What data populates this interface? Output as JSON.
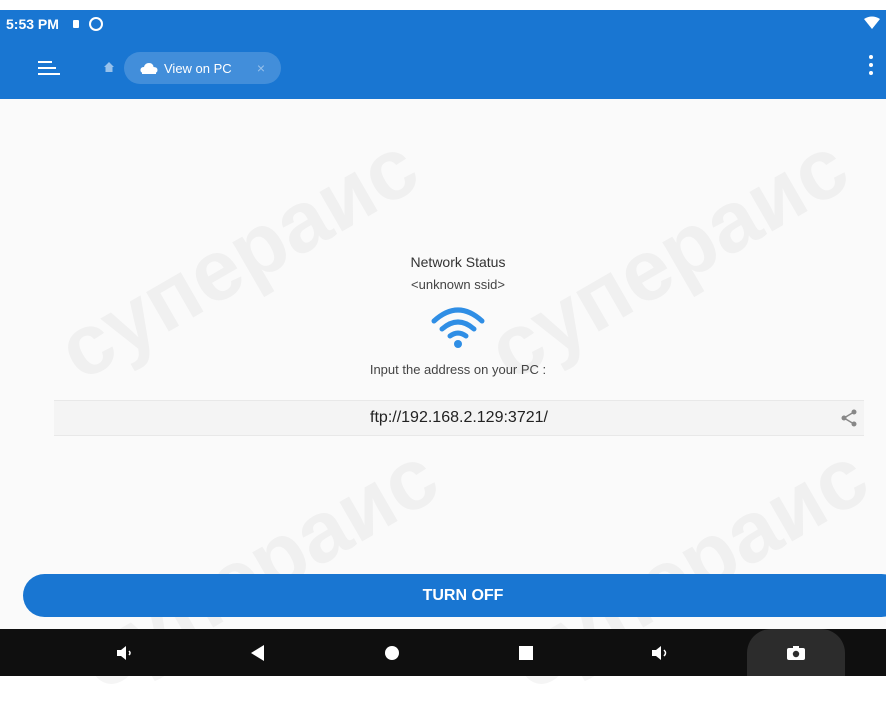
{
  "status_bar": {
    "time": "5:53 PM"
  },
  "toolbar": {
    "tab_label": "View on PC",
    "close_glyph": "×"
  },
  "network": {
    "title": "Network Status",
    "ssid": "<unknown ssid>",
    "address_hint": "Input the address on your PC :",
    "address": "ftp://192.168.2.129:3721/"
  },
  "action": {
    "turn_off_label": "TURN OFF"
  },
  "watermark": {
    "text": "супераис"
  },
  "icons": [
    "menu-icon",
    "home-icon",
    "cloud-icon",
    "close-icon",
    "more-vert-icon",
    "wifi-icon",
    "share-icon",
    "volume-down-icon",
    "back-icon",
    "home-nav-icon",
    "recents-icon",
    "volume-up-icon",
    "camera-icon"
  ],
  "colors": {
    "primary": "#1976d2",
    "background": "#fafafa",
    "nav_bar": "#0f0f0f"
  }
}
